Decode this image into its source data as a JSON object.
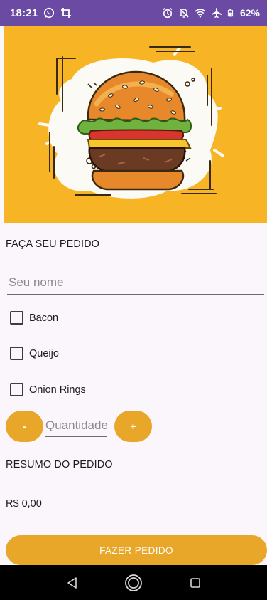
{
  "status_bar": {
    "time": "18:21",
    "battery": "62%",
    "icons_left": [
      "whatsapp-icon",
      "crop-icon"
    ],
    "icons_right": [
      "alarm-icon",
      "notifications-off-icon",
      "wifi-icon",
      "airplane-icon",
      "battery-icon"
    ]
  },
  "hero": {
    "icon": "burger-illustration",
    "background_color": "#f7b525"
  },
  "form": {
    "title": "FAÇA SEU PEDIDO",
    "name_placeholder": "Seu nome",
    "name_value": "",
    "options": [
      {
        "label": "Bacon",
        "checked": false
      },
      {
        "label": "Queijo",
        "checked": false
      },
      {
        "label": "Onion Rings",
        "checked": false
      }
    ],
    "decrement_label": "-",
    "increment_label": "+",
    "quantity_placeholder": "Quantidade",
    "quantity_value": ""
  },
  "summary": {
    "title": "RESUMO DO PEDIDO",
    "total": "R$ 0,00"
  },
  "actions": {
    "order_button": "FAZER PEDIDO"
  },
  "colors": {
    "accent": "#e8a728",
    "status_bar": "#6b4aa4",
    "background": "#fbf6fb"
  },
  "nav_bar": {
    "buttons": [
      "back-icon",
      "home-icon",
      "recents-icon"
    ]
  }
}
